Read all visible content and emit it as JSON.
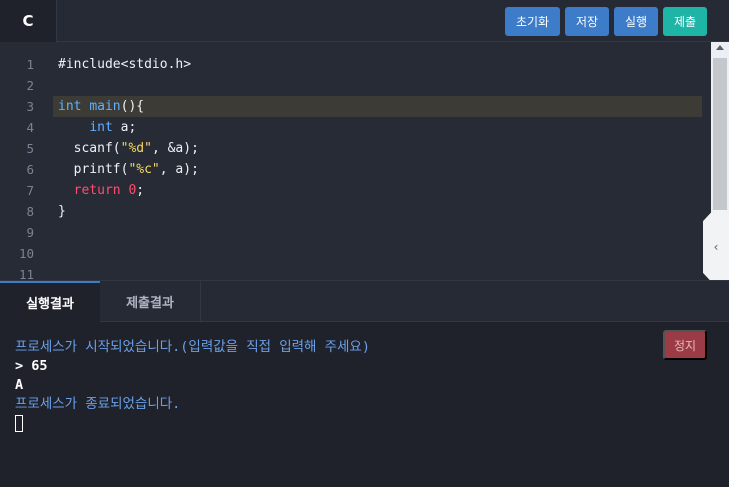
{
  "header": {
    "language_tab": "C",
    "buttons": {
      "reset": "초기화",
      "save": "저장",
      "run": "실행",
      "submit": "제출"
    }
  },
  "editor": {
    "line_numbers": [
      "1",
      "2",
      "3",
      "4",
      "5",
      "6",
      "7",
      "8",
      "9",
      "10",
      "11"
    ],
    "active_line": 3,
    "code": [
      "#include<stdio.h>",
      "",
      "int main(){",
      "    int a;",
      "  scanf(\"%d\", &a);",
      "  printf(\"%c\", a);",
      "  return 0;",
      "}",
      "",
      "",
      ""
    ]
  },
  "result": {
    "tabs": [
      "실행결과",
      "제출결과"
    ],
    "stop_button": "정지",
    "console_lines": [
      {
        "type": "info",
        "text": "프로세스가 시작되었습니다.(입력값을 직접 입력해 주세요)"
      },
      {
        "type": "user",
        "text": "> 65"
      },
      {
        "type": "user",
        "text": "A"
      },
      {
        "type": "info",
        "text": "프로세스가 종료되었습니다."
      }
    ]
  },
  "colors": {
    "accent": "#3d7cc9",
    "submit": "#1fb5a6",
    "stop": "#9b3b45",
    "info_text": "#6aa0e8"
  },
  "icons": {
    "scroll_up": "triangle-up-icon",
    "collapse": "chevron-left-icon"
  }
}
